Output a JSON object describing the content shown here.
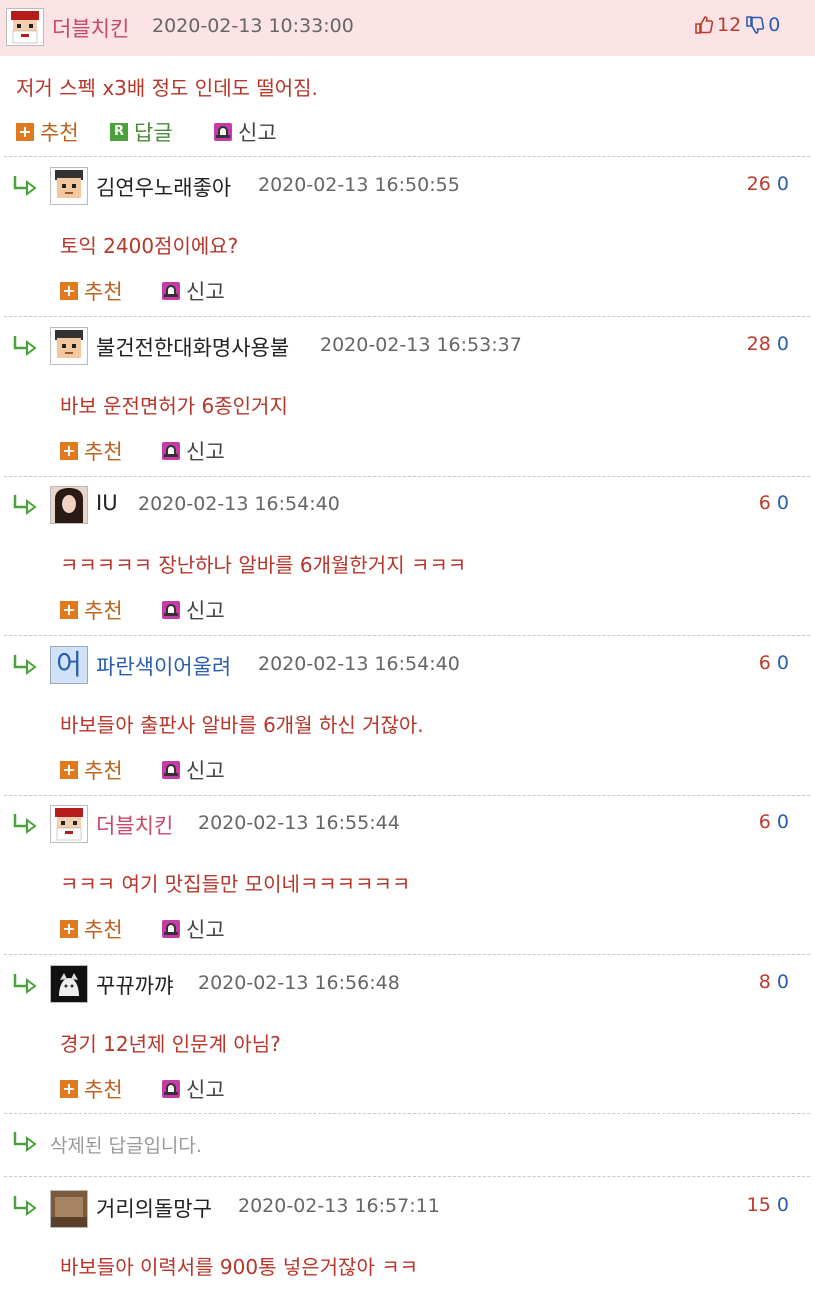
{
  "main_comment": {
    "nick": "더블치킨",
    "date": "2020-02-13 10:33:00",
    "likes": "12",
    "dislikes": "0",
    "text": "저거 스펙 x3배 정도 인데도 떨어짐.",
    "recommend_label": "추천",
    "reply_label": "답글",
    "report_label": "신고",
    "reply_icon_letter": "R"
  },
  "replies": [
    {
      "nick": "김연우노래좋아",
      "date": "2020-02-13 16:50:55",
      "up": "26",
      "down": "0",
      "text": "토익 2400점이에요?",
      "avatar": "pixel-face-avatar"
    },
    {
      "nick": "불건전한대화명사용불",
      "date": "2020-02-13 16:53:37",
      "up": "28",
      "down": "0",
      "text": "바보 운전면허가 6종인거지",
      "avatar": "pixel-face-avatar"
    },
    {
      "nick": "IU",
      "date": "2020-02-13 16:54:40",
      "up": "6",
      "down": "0",
      "text": "ㅋㅋㅋㅋㅋ 장난하나 알바를 6개월한거지 ㅋㅋㅋ",
      "avatar": "photo-avatar"
    },
    {
      "nick": "파란색이어울려",
      "date": "2020-02-13 16:54:40",
      "up": "6",
      "down": "0",
      "text": "바보들아 출판사 알바를 6개월 하신 거잖아.",
      "avatar": "text-avatar",
      "avatar_text": "어"
    },
    {
      "nick": "더블치킨",
      "date": "2020-02-13 16:55:44",
      "up": "6",
      "down": "0",
      "text": "ㅋㅋㅋ 여기 맛집들만 모이네ㅋㅋㅋㅋㅋㅋ",
      "avatar": "santa-avatar"
    },
    {
      "nick": "꾸뀨까꺄",
      "date": "2020-02-13 16:56:48",
      "up": "8",
      "down": "0",
      "text": "경기 12년제 인문계 아님?",
      "avatar": "cat-avatar"
    }
  ],
  "deleted_text": "삭제된 답글입니다.",
  "last_reply": {
    "nick": "거리의돌망구",
    "date": "2020-02-13 16:57:11",
    "up": "15",
    "down": "0",
    "text": "바보들아 이력서를 900통 넣은거잖아 ㅋㅋ",
    "avatar": "photo-avatar"
  },
  "actions": {
    "recommend": "추천",
    "report": "신고"
  },
  "colors": {
    "top_bg": "#fbe3e6",
    "text_red": "#b8352a",
    "nick_pink": "#c7486b",
    "nick_blue": "#2a5db0",
    "reply_green": "#4aa33a",
    "recommend_orange": "#e07a1f",
    "report_purple": "#c73ba9"
  },
  "icons": {
    "like": "thumbs-up-icon",
    "dislike": "thumbs-down-icon",
    "reply_arrow": "reply-arrow-icon"
  }
}
